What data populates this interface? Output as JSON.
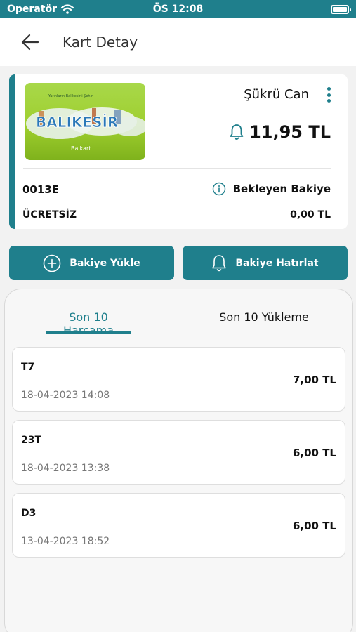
{
  "status_bar": {
    "carrier": "Operatör",
    "time": "ÖS 12:08"
  },
  "header": {
    "title": "Kart Detay"
  },
  "card": {
    "owner": "Şükrü Can",
    "balance": "11,95 TL",
    "card_number": "0013E",
    "card_type": "ÜCRETSİZ",
    "pending_label": "Bekleyen Bakiye",
    "pending_amount": "0,00 TL",
    "image_text": "BALIKESİR",
    "image_brand": "Balkart",
    "image_tagline": "Yarınların Balıkesir'i Şehir"
  },
  "actions": {
    "load_label": "Bakiye Yükle",
    "remind_label": "Bakiye Hatırlat"
  },
  "tabs": [
    {
      "label": "Son 10 Harcama",
      "active": true
    },
    {
      "label": "Son 10 Yükleme",
      "active": false
    }
  ],
  "transactions": [
    {
      "line": "T7",
      "date": "18-04-2023 14:08",
      "amount": "7,00 TL"
    },
    {
      "line": "23T",
      "date": "18-04-2023 13:38",
      "amount": "6,00 TL"
    },
    {
      "line": "D3",
      "date": "13-04-2023 18:52",
      "amount": "6,00 TL"
    }
  ],
  "colors": {
    "accent": "#1f7f8c",
    "background": "#f2f2f2"
  },
  "icons": [
    "wifi-icon",
    "battery-icon",
    "back-arrow-icon",
    "more-vertical-icon",
    "bell-icon",
    "info-icon",
    "plus-circle-icon"
  ]
}
